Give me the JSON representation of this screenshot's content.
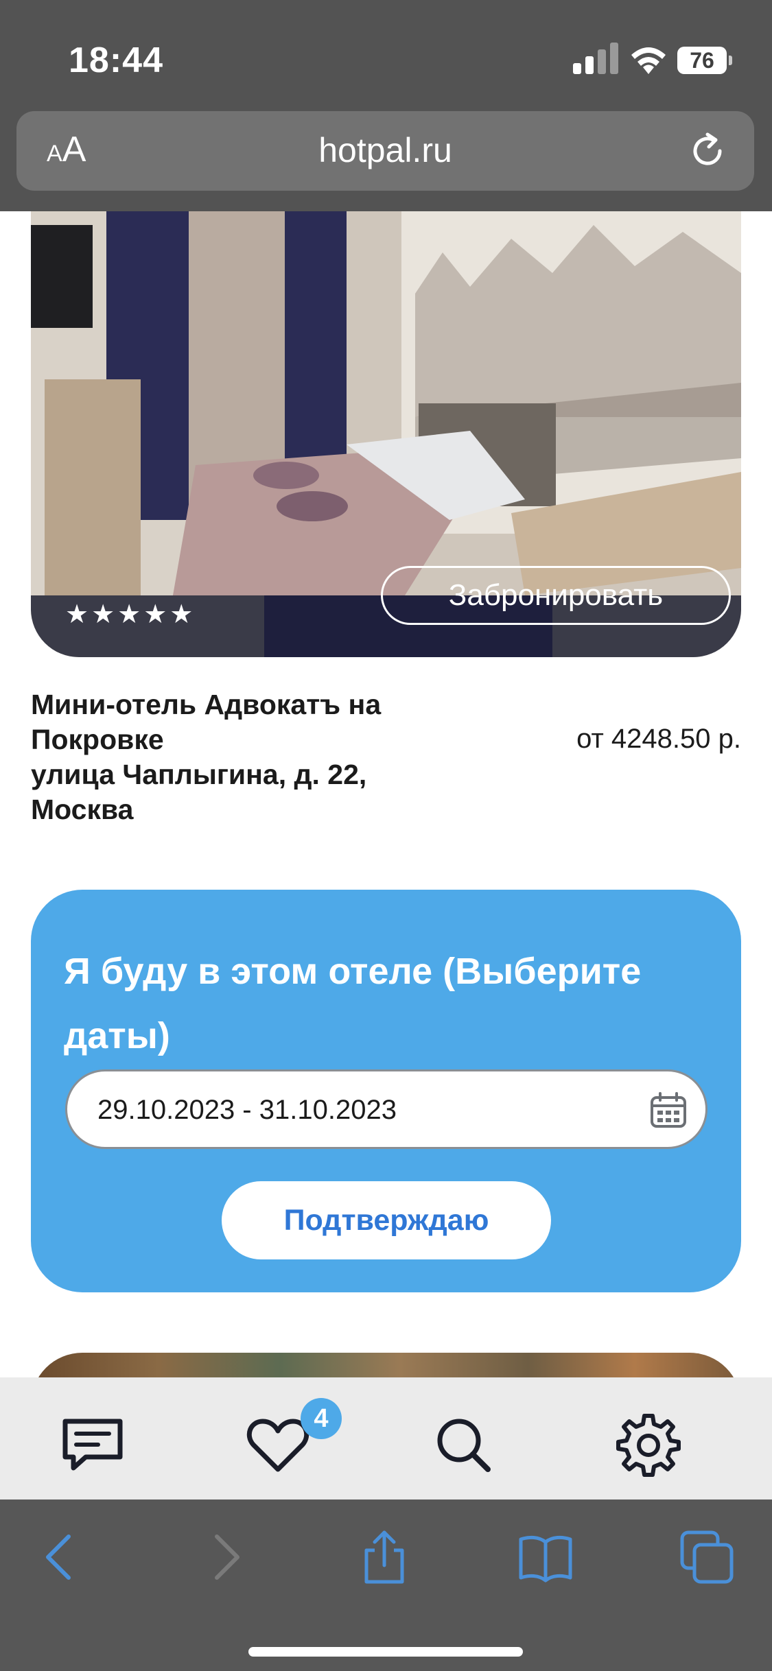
{
  "status_bar": {
    "time": "18:44",
    "battery": "76",
    "icons": [
      "cellular-signal-icon",
      "wifi-icon",
      "battery-icon"
    ]
  },
  "browser": {
    "text_size_small": "A",
    "text_size_big": "A",
    "url": "hotpal.ru",
    "reload_icon": "reload-icon"
  },
  "hotel": {
    "stars": "★★★★★",
    "book_label": "Забронировать",
    "name": "Мини-отель Адвокатъ на Покровке",
    "address": "улица Чаплыгина, д. 22, Москва",
    "price": "от 4248.50 р."
  },
  "booking": {
    "title": "Я буду в этом отеле (Выберите даты)",
    "date_range": "29.10.2023 - 31.10.2023",
    "calendar_icon": "calendar-icon",
    "confirm_label": "Подтверждаю"
  },
  "app_nav": {
    "items": [
      "messages-icon",
      "favorites-icon",
      "search-icon",
      "settings-icon"
    ],
    "favorites_badge": "4",
    "accent_color": "#4ea9e8"
  },
  "safari_toolbar": {
    "items": [
      "back-icon",
      "forward-icon",
      "share-icon",
      "bookmarks-icon",
      "tabs-icon"
    ],
    "accent_color": "#4a90d9"
  }
}
